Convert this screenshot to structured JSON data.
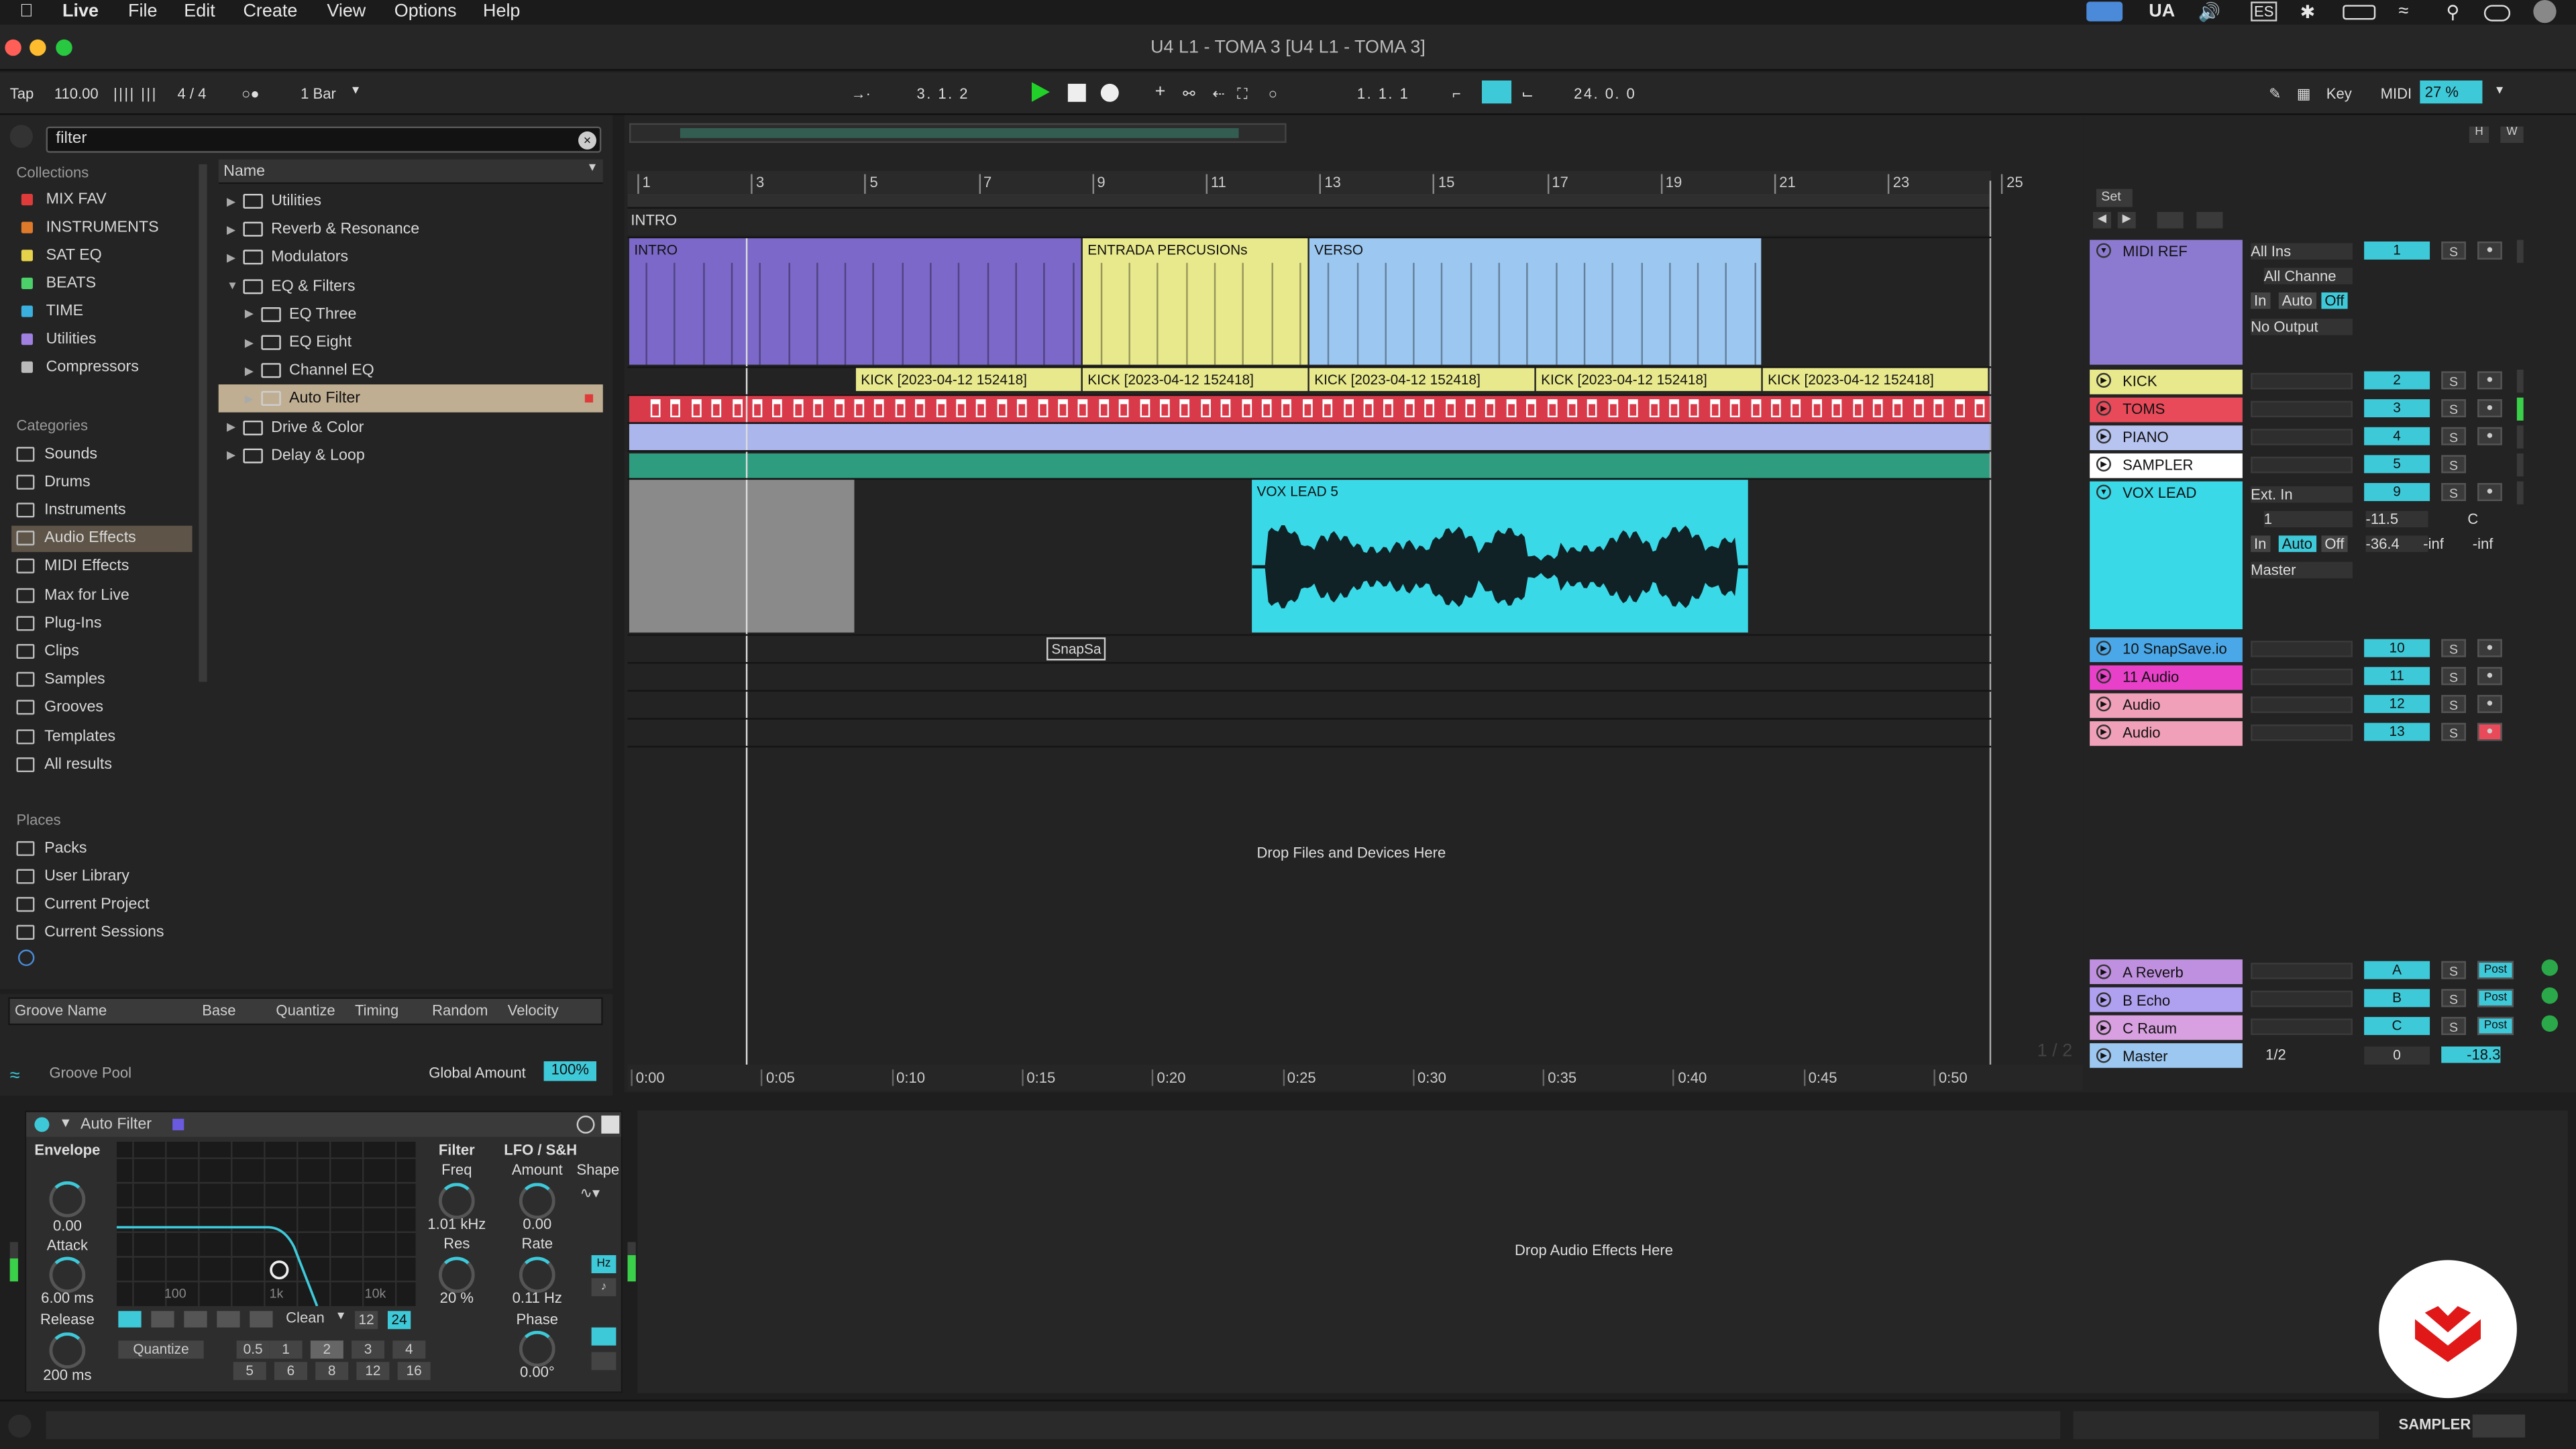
{
  "menubar": {
    "app": "Live",
    "items": [
      "File",
      "Edit",
      "Create",
      "View",
      "Options",
      "Help"
    ],
    "right": [
      "UA",
      "ES"
    ]
  },
  "window": {
    "title": "U4 L1 - TOMA 3  [U4 L1 - TOMA 3]"
  },
  "transport": {
    "tap": "Tap",
    "tempo": "110.00",
    "signature": "4 / 4",
    "quantize": "1 Bar",
    "position": "3.   1.   2",
    "loop_start": "1.   1.   1",
    "loop_length": "24.   0.   0",
    "key": "Key",
    "midi": "MIDI",
    "cpu": "27 %"
  },
  "browser": {
    "search": "filter",
    "collections_label": "Collections",
    "collections": [
      {
        "label": "MIX FAV",
        "color": "#e03b3b"
      },
      {
        "label": "INSTRUMENTS",
        "color": "#e07a2b"
      },
      {
        "label": "SAT EQ",
        "color": "#e6d24b"
      },
      {
        "label": "BEATS",
        "color": "#4bd06a"
      },
      {
        "label": "TIME",
        "color": "#3ab0e0"
      },
      {
        "label": "Utilities",
        "color": "#a080e0"
      },
      {
        "label": "Compressors",
        "color": "#bbbbbb"
      }
    ],
    "categories_label": "Categories",
    "categories": [
      "Sounds",
      "Drums",
      "Instruments",
      "Audio Effects",
      "MIDI Effects",
      "Max for Live",
      "Plug-Ins",
      "Clips",
      "Samples",
      "Grooves",
      "Templates",
      "All results"
    ],
    "places_label": "Places",
    "places": [
      "Packs",
      "User Library",
      "Current Project",
      "Current Sessions"
    ],
    "name_header": "Name",
    "tree": [
      {
        "label": "Utilities",
        "level": 0
      },
      {
        "label": "Reverb & Resonance",
        "level": 0
      },
      {
        "label": "Modulators",
        "level": 0
      },
      {
        "label": "EQ & Filters",
        "level": 0
      },
      {
        "label": "EQ Three",
        "level": 1
      },
      {
        "label": "EQ Eight",
        "level": 1
      },
      {
        "label": "Channel EQ",
        "level": 1
      },
      {
        "label": "Auto Filter",
        "level": 1
      },
      {
        "label": "Drive & Color",
        "level": 0
      },
      {
        "label": "Delay & Loop",
        "level": 0
      }
    ]
  },
  "groove": {
    "columns": [
      "Groove Name",
      "Base",
      "Quantize",
      "Timing",
      "Random",
      "Velocity"
    ],
    "pool": "Groove Pool",
    "global_amount_label": "Global Amount",
    "global_amount": "100%"
  },
  "arrangement": {
    "bars": [
      "1",
      "3",
      "5",
      "7",
      "9",
      "11",
      "13",
      "15",
      "17",
      "19",
      "21",
      "23",
      "25"
    ],
    "locator": "INTRO",
    "sections": [
      {
        "label": "INTRO",
        "color": "#7b68c8"
      },
      {
        "label": "ENTRADA PERCUSIONs",
        "color": "#e8e98c"
      },
      {
        "label": "VERSO",
        "color": "#9cc7f0"
      }
    ],
    "kick_clip": "KICK [2023-04-12 152418]",
    "vox_clip": "VOX LEAD 5",
    "snap_clip": "SnapSa",
    "drop_hint": "Drop Files and Devices Here",
    "times": [
      "0:00",
      "0:05",
      "0:10",
      "0:15",
      "0:20",
      "0:25",
      "0:30",
      "0:35",
      "0:40",
      "0:45",
      "0:50"
    ],
    "page": "1 / 2"
  },
  "mixer": {
    "set_label": "Set",
    "tracks": [
      {
        "name": "MIDI REF",
        "num": "1",
        "color": "#8c7ad0"
      },
      {
        "name": "KICK",
        "num": "2",
        "color": "#e8e98c"
      },
      {
        "name": "TOMS",
        "num": "3",
        "color": "#e84a5a"
      },
      {
        "name": "PIANO",
        "num": "4",
        "color": "#b8c4f0"
      },
      {
        "name": "SAMPLER",
        "num": "5",
        "color": "#ffffff"
      },
      {
        "name": "VOX LEAD",
        "num": "9",
        "color": "#3ad9e8"
      },
      {
        "name": "10 SnapSave.io",
        "num": "10",
        "color": "#4aa8e8"
      },
      {
        "name": "11 Audio",
        "num": "11",
        "color": "#e840c8"
      },
      {
        "name": "Audio",
        "num": "12",
        "color": "#f0a0b8"
      },
      {
        "name": "Audio",
        "num": "13",
        "color": "#f0a0b8"
      }
    ],
    "returns": [
      {
        "name": "A Reverb",
        "num": "A",
        "color": "#c090e0"
      },
      {
        "name": "B Echo",
        "num": "B",
        "color": "#b0a0f0"
      },
      {
        "name": "C Raum",
        "num": "C",
        "color": "#d8a0e0"
      }
    ],
    "master": {
      "name": "Master",
      "num": "0",
      "value": "-18.3",
      "routing": "1/2"
    },
    "midi_ref_io": {
      "in": "All Ins",
      "channel": "All Channe",
      "out": "No Output"
    },
    "vox_io": {
      "in": "Ext. In",
      "channel": "1",
      "out": "Master",
      "volume": "-11.5",
      "pan": "C",
      "peak": "-36.4",
      "l": "-inf",
      "r": "-inf"
    },
    "monitor": [
      "In",
      "Auto",
      "Off"
    ],
    "s_label": "S",
    "post_label": "Post"
  },
  "device": {
    "name": "Auto Filter",
    "envelope": "Envelope",
    "env_amount": "0.00",
    "attack_label": "Attack",
    "attack": "6.00 ms",
    "release_label": "Release",
    "release": "200 ms",
    "freq_ticks": [
      "100",
      "1k",
      "10k"
    ],
    "filter_label": "Filter",
    "freq_label": "Freq",
    "freq": "1.01 kHz",
    "res_label": "Res",
    "res": "20 %",
    "lfo_label": "LFO / S&H",
    "amount_label": "Amount",
    "amount": "0.00",
    "rate_label": "Rate",
    "rate": "0.11 Hz",
    "phase_label": "Phase",
    "phase": "0.00°",
    "shape_label": "Shape",
    "circuit": "Clean",
    "slope12": "12",
    "slope24": "24",
    "hz": "Hz",
    "quantize": "Quantize",
    "qvals": [
      "0.5",
      "1",
      "2",
      "3",
      "4",
      "5",
      "6",
      "8",
      "12",
      "16"
    ]
  },
  "devdrop": "Drop Audio Effects Here",
  "status": {
    "track": "SAMPLER"
  }
}
